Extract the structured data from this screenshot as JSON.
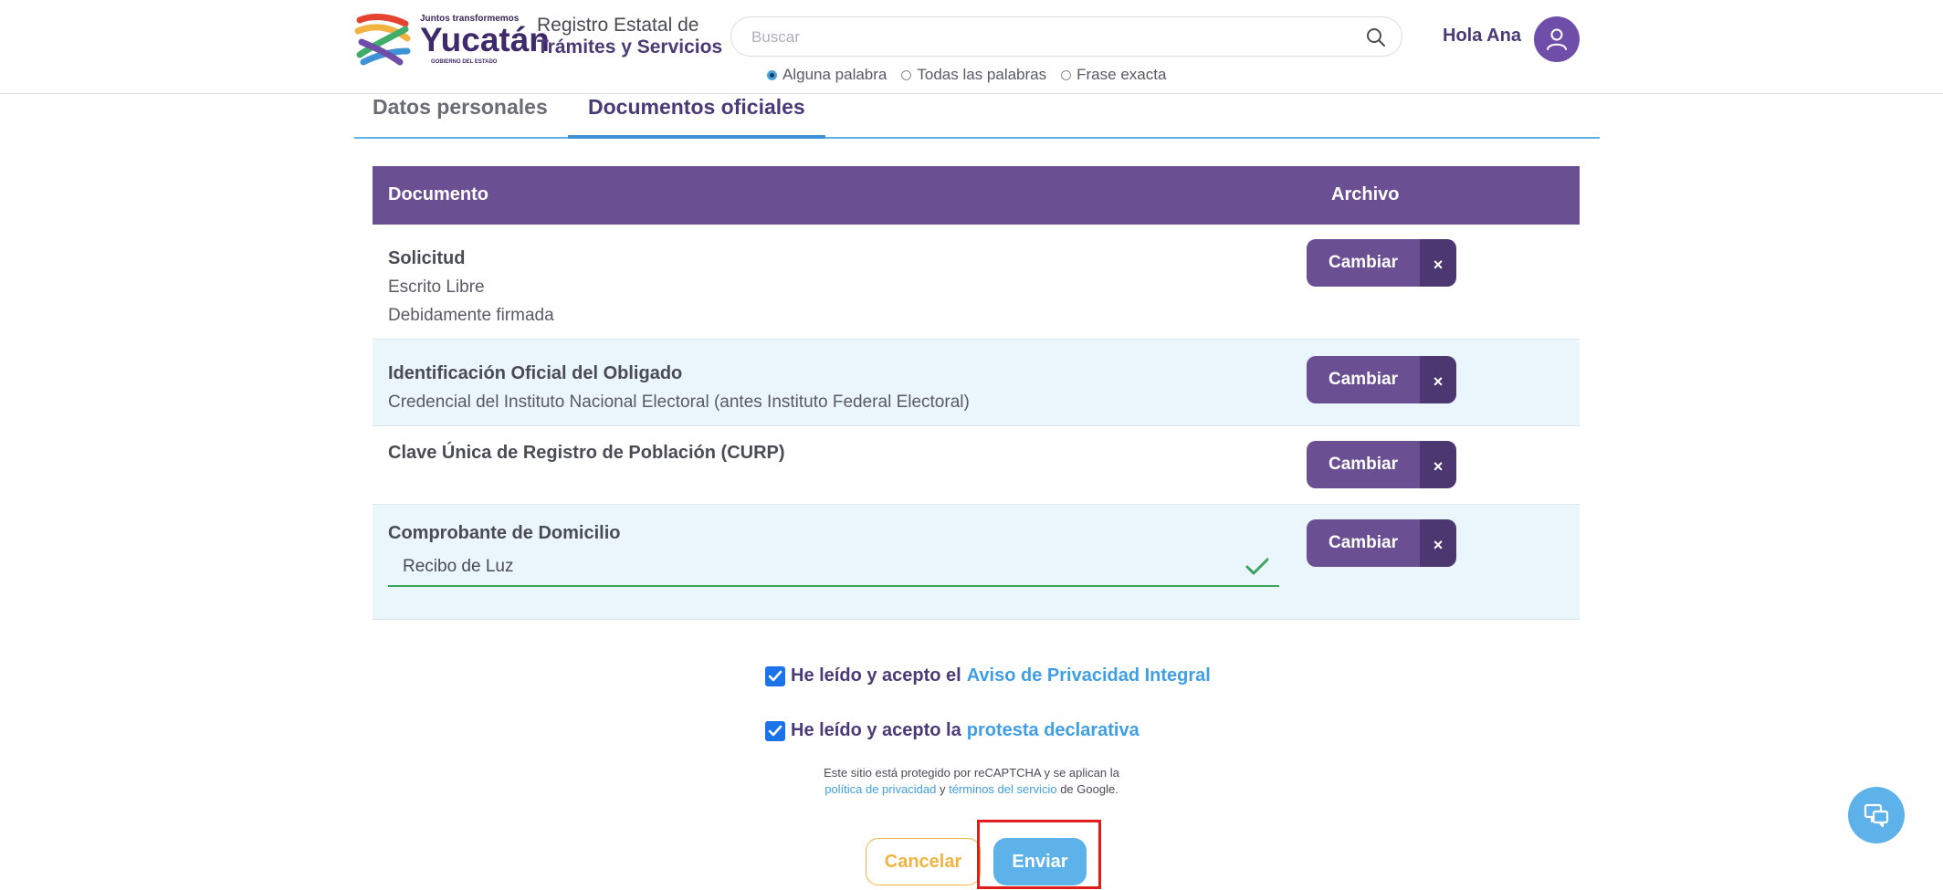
{
  "header": {
    "logo": {
      "tagline": "Juntos transformemos",
      "wordmark": "Yucatán",
      "subline": "GOBIERNO DEL ESTADO"
    },
    "site_title": {
      "line1": "Registro Estatal de",
      "line2": "Trámites y Servicios"
    },
    "search": {
      "placeholder": "Buscar",
      "value": "",
      "options": [
        {
          "label": "Alguna palabra",
          "selected": true
        },
        {
          "label": "Todas las palabras",
          "selected": false
        },
        {
          "label": "Frase exacta",
          "selected": false
        }
      ]
    },
    "greeting": "Hola Ana",
    "icons": {
      "search": "search-icon",
      "avatar": "user-icon"
    }
  },
  "tabs": [
    {
      "label": "Datos personales",
      "active": false
    },
    {
      "label": "Documentos oficiales",
      "active": true
    }
  ],
  "table": {
    "columns": [
      "Documento",
      "Archivo"
    ],
    "rows": [
      {
        "title": "Solicitud",
        "lines": [
          "Escrito Libre",
          "Debidamente firmada"
        ],
        "change_label": "Cambiar",
        "remove_label": "×"
      },
      {
        "title": "Identificación Oficial del Obligado",
        "lines": [
          "Credencial del Instituto Nacional Electoral (antes Instituto Federal Electoral)"
        ],
        "change_label": "Cambiar",
        "remove_label": "×"
      },
      {
        "title": "Clave Única de Registro de Población (CURP)",
        "lines": [],
        "change_label": "Cambiar",
        "remove_label": "×"
      },
      {
        "title": "Comprobante de Domicilio",
        "input_value": "Recibo de Luz",
        "input_valid": true,
        "change_label": "Cambiar",
        "remove_label": "×"
      }
    ]
  },
  "consent": [
    {
      "checked": true,
      "prefix": "He leído y acepto el",
      "link": "Aviso de Privacidad Integral"
    },
    {
      "checked": true,
      "prefix": "He leído y acepto la",
      "link": "protesta declarativa"
    }
  ],
  "recaptcha": {
    "line1": "Este sitio está protegido por reCAPTCHA y se aplican la",
    "privacy_link": "política de privacidad",
    "and": "y",
    "terms_link": "términos del servicio",
    "suffix": "de Google."
  },
  "actions": {
    "cancel_label": "Cancelar",
    "send_label": "Enviar"
  },
  "colors": {
    "brand_purple": "#6a4f92",
    "accent_blue": "#5db2ea",
    "cancel_orange": "#f2b441",
    "highlight_red": "#e11c1c",
    "valid_green": "#3aa55c"
  },
  "chat_button": {
    "icon": "chat-icon"
  }
}
